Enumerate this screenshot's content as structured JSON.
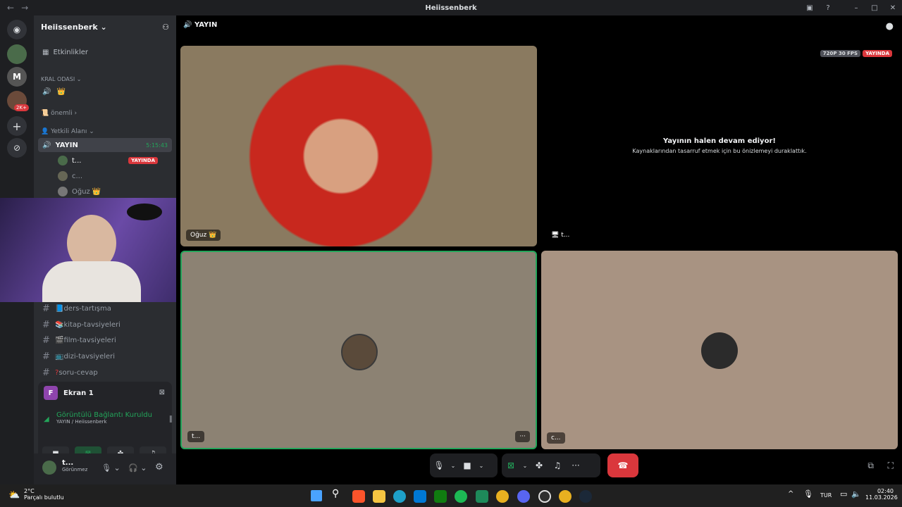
{
  "window": {
    "title": "Heiissenberk"
  },
  "server": {
    "name": "Heiissenberk"
  },
  "channels": {
    "events": "Etkinlikler",
    "category_kral": "KRAL ODASI",
    "onemli": "önemli",
    "yetkili": "Yetkili Alanı",
    "yayin": "YAYIN",
    "yayin_timer": "5:15:43",
    "members": [
      {
        "name": "t...",
        "badge": "YAYINDA"
      },
      {
        "name": "c...",
        "badge": ""
      },
      {
        "name": "Oğuz",
        "badge": ""
      }
    ],
    "text": [
      "ders-tartışma",
      "kitap-tavsiyeleri",
      "film-tavsiyeleri",
      "dizi-tavsiyeleri",
      "soru-cevap"
    ]
  },
  "screen_share": {
    "title": "Ekran 1"
  },
  "voice": {
    "status": "Görüntülü Bağlantı Kuruldu",
    "channel": "YAYIN",
    "server": "/ Heiissenberk"
  },
  "user": {
    "name": "t...",
    "status": "Görünmez"
  },
  "stage": {
    "channel": "YAYIN",
    "tile1_name": "Oğuz",
    "quality": "720P 30 FPS",
    "live": "YAYINDA",
    "paused_title": "Yayının halen devam ediyor!",
    "paused_sub": "Kaynaklarından tasarruf etmek için bu önizlemeyi duraklattık.",
    "tile2_name": "t...",
    "tile3_name": "t...",
    "tile4_name": "c..."
  },
  "guild_badge": "2K+",
  "taskbar": {
    "weather_temp": "2°C",
    "weather_desc": "Parçalı bulutlu",
    "lang": "TUR",
    "time": "02:40",
    "date": "11.03.2026"
  },
  "colors": {
    "accent_green": "#23a55a",
    "live_red": "#da373c",
    "blurple": "#5865f2"
  }
}
